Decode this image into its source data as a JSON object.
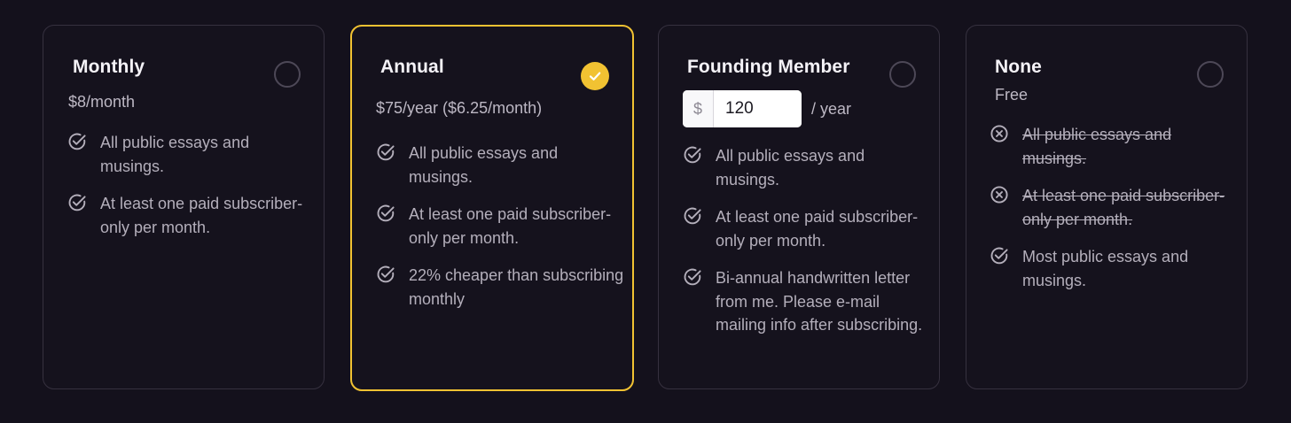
{
  "plans": [
    {
      "title": "Monthly",
      "price": "$8/month",
      "selected": false,
      "features": [
        {
          "text": "All public essays and musings.",
          "included": true
        },
        {
          "text": "At least one paid subscriber-only per month.",
          "included": true
        }
      ]
    },
    {
      "title": "Annual",
      "price": "$75/year ($6.25/month)",
      "selected": true,
      "features": [
        {
          "text": "All public essays and musings.",
          "included": true
        },
        {
          "text": "At least one paid subscriber-only per month.",
          "included": true
        },
        {
          "text": "22% cheaper than subscribing monthly",
          "included": true
        }
      ]
    },
    {
      "title": "Founding Member",
      "currency_symbol": "$",
      "amount_value": "120",
      "period": "/ year",
      "selected": false,
      "features": [
        {
          "text": "All public essays and musings.",
          "included": true
        },
        {
          "text": "At least one paid subscriber-only per month.",
          "included": true
        },
        {
          "text": "Bi-annual handwritten letter from me. Please e-mail mailing info after subscribing.",
          "included": true
        }
      ]
    },
    {
      "title": "None",
      "price": "Free",
      "selected": false,
      "features": [
        {
          "text": "All public essays and musings.",
          "included": false
        },
        {
          "text": "At least one paid subscriber-only per month.",
          "included": false
        },
        {
          "text": "Most public essays and musings.",
          "included": true
        }
      ]
    }
  ],
  "icons": {
    "included": "check-circle-icon",
    "excluded": "x-circle-icon",
    "selected": "checkmark-icon"
  },
  "colors": {
    "background": "#14111c",
    "card_border": "#36313f",
    "accent": "#f1c232",
    "title_text": "#f4f2f7",
    "body_text": "#b4afbb"
  }
}
